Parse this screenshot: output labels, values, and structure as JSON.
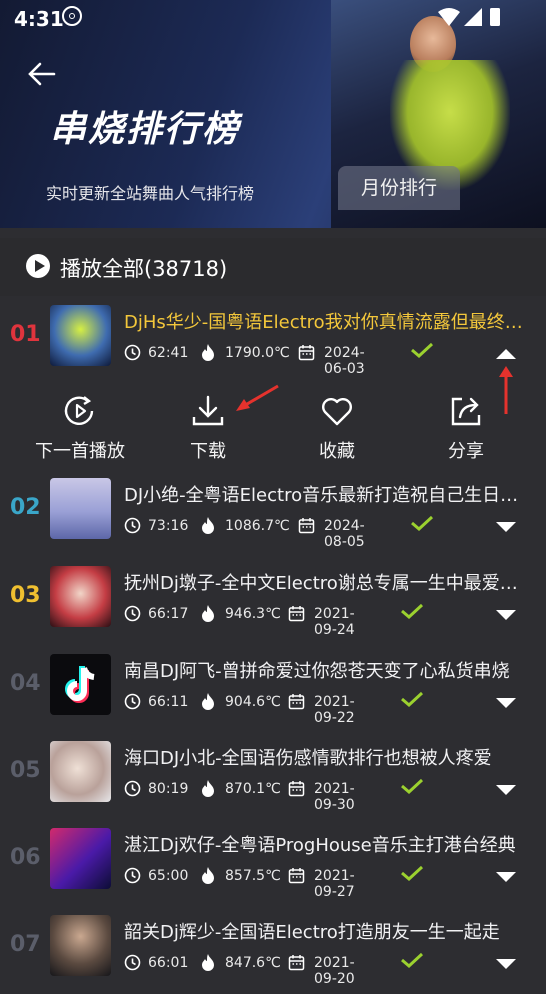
{
  "status": {
    "time": "4:31"
  },
  "header": {
    "title": "串烧排行榜",
    "subtitle": "实时更新全站舞曲人气排行榜",
    "month_button": "月份排行"
  },
  "play_all": {
    "label": "播放全部(38718)"
  },
  "actions": [
    {
      "label": "下一首播放",
      "icon": "play-next-icon"
    },
    {
      "label": "下载",
      "icon": "download-icon"
    },
    {
      "label": "收藏",
      "icon": "heart-icon"
    },
    {
      "label": "分享",
      "icon": "share-icon"
    }
  ],
  "colors": {
    "rank1": "#e0343d",
    "rank2": "#3aa6c9",
    "rank3": "#f0c030",
    "rank_other": "#5b5e6a",
    "active_title": "#f3c73b",
    "check": "#9bd12f"
  },
  "songs": [
    {
      "rank": "01",
      "title": "DjHs华少-国粤语Electro我对你真情流露但最终得到是痛苦",
      "duration": "62:41",
      "heat": "1790.0℃",
      "date": "2024-06-03",
      "expanded": true
    },
    {
      "rank": "02",
      "title": "DJ小绝-全粤语Electro音乐最新打造祝自己生日快乐",
      "duration": "73:16",
      "heat": "1086.7℃",
      "date": "2024-08-05"
    },
    {
      "rank": "03",
      "title": "抚州Dj墩子-全中文Electro谢总专属一生中最爱的人",
      "duration": "66:17",
      "heat": "946.3℃",
      "date": "2021-09-24"
    },
    {
      "rank": "04",
      "title": "南昌DJ阿飞-曾拼命爱过你怨苍天变了心私货串烧",
      "duration": "66:11",
      "heat": "904.6℃",
      "date": "2021-09-22"
    },
    {
      "rank": "05",
      "title": "海口DJ小北-全国语伤感情歌排行也想被人疼爱",
      "duration": "80:19",
      "heat": "870.1℃",
      "date": "2021-09-30"
    },
    {
      "rank": "06",
      "title": "湛江Dj欢仔-全粤语ProgHouse音乐主打港台经典",
      "duration": "65:00",
      "heat": "857.5℃",
      "date": "2021-09-27"
    },
    {
      "rank": "07",
      "title": "韶关Dj辉少-全国语Electro打造朋友一生一起走",
      "duration": "66:01",
      "heat": "847.6℃",
      "date": "2021-09-20"
    }
  ]
}
